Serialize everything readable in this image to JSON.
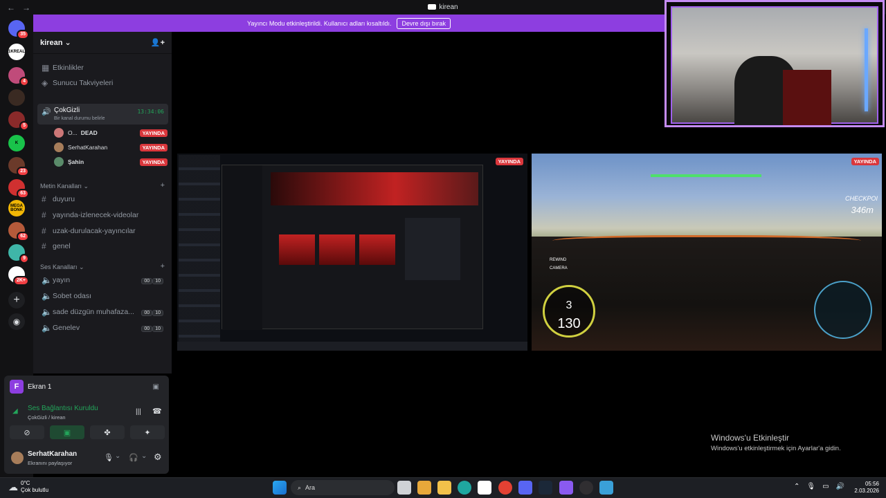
{
  "window": {
    "title": "kirean"
  },
  "banner": {
    "text": "Yayıncı Modu etkinleştirildi. Kullanıcı adları kısaltıldı.",
    "button": "Devre dışı bırak"
  },
  "servers": [
    {
      "color": "#5865f2",
      "badge": "35"
    },
    {
      "color": "#ffffff",
      "badge": "",
      "label": "1KREAL"
    },
    {
      "color": "#c04b7a",
      "badge": "4"
    },
    {
      "color": "#3a2a22",
      "badge": ""
    },
    {
      "color": "#8a2a2a",
      "badge": "5"
    },
    {
      "color": "#19c34a",
      "badge": "",
      "label": "K"
    },
    {
      "color": "#6b3a2a",
      "badge": "23"
    },
    {
      "color": "#d03030",
      "badge": "63"
    },
    {
      "color": "#f2b705",
      "badge": "",
      "label": "MEGA BONK"
    },
    {
      "color": "#b55a3a",
      "badge": "62"
    },
    {
      "color": "#3fb6a8",
      "badge": "9"
    },
    {
      "color": "#ffffff",
      "badge": "2K+"
    }
  ],
  "guild": {
    "name": "kirean",
    "top_items": [
      "Etkinlikler",
      "Sunucu Takviyeleri"
    ],
    "voice_active": {
      "name": "ÇokGizli",
      "status": "Bir kanal durumu belirle",
      "time": "13:34:06",
      "users": [
        {
          "name": "O...",
          "tag": "DEAD",
          "live": "YAYINDA"
        },
        {
          "name": "SerhatKarahan",
          "tag": "",
          "live": "YAYINDA"
        },
        {
          "name": "Şahin",
          "tag": "",
          "live": "YAYINDA"
        }
      ]
    },
    "text_category": "Metin Kanalları",
    "text_channels": [
      "duyuru",
      "yayında-izlenecek-videolar",
      "uzak-durulacak-yayıncılar",
      "genel"
    ],
    "voice_category": "Ses Kanalları",
    "voice_channels": [
      {
        "name": "yayın",
        "a": "00",
        "b": "10"
      },
      {
        "name": "Sobet odası",
        "a": "",
        "b": ""
      },
      {
        "name": "sade düzgün muhafaza...",
        "a": "00",
        "b": "10"
      },
      {
        "name": "Genelev",
        "a": "00",
        "b": "10"
      }
    ]
  },
  "panel": {
    "screen_label": "Ekran 1",
    "screen_initial": "F",
    "connection": "Ses Bağlantısı Kuruldu",
    "connection_sub": "ÇokGizli / kirean",
    "user_name": "SerhatKarahan",
    "user_status": "Ekranını paylaşıyor"
  },
  "streams": {
    "left_live": "YAYINDA",
    "right_live": "YAYINDA"
  },
  "game_hud": {
    "gear": "3",
    "speed": "130",
    "distance": "346m",
    "rewind": "REWIND",
    "camera": "CAMERA",
    "checkpoint": "CHECKPOI"
  },
  "watermark": {
    "title": "Windows'u Etkinleştir",
    "subtitle": "Windows'u etkinleştirmek için Ayarlar'a gidin."
  },
  "taskbar": {
    "weather_temp": "0°C",
    "weather_desc": "Çok bulutlu",
    "search": "Ara",
    "time": "05:56",
    "date": "2.03.2026"
  }
}
